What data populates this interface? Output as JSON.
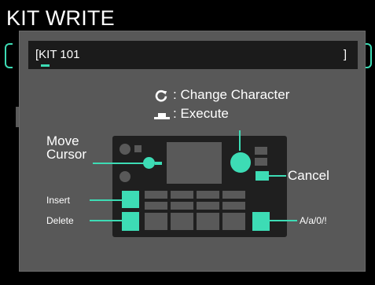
{
  "screen": {
    "title": "KIT WRITE"
  },
  "dialog": {
    "name_field": {
      "open": "[",
      "value": "KIT 101",
      "close": "]"
    },
    "legend": {
      "change": ": Change Character",
      "execute": ": Execute"
    },
    "labels": {
      "move_cursor_1": "Move",
      "move_cursor_2": "Cursor",
      "cancel": "Cancel",
      "insert": "Insert",
      "delete": "Delete",
      "case": "A/a/0/!"
    }
  },
  "colors": {
    "accent": "#3ddcb5",
    "dialog_bg": "#585858",
    "device_bg": "#1f1f1f",
    "field_bg": "#1b1b1b"
  },
  "icons": [
    "rotate-knob-icon",
    "execute-press-icon"
  ]
}
